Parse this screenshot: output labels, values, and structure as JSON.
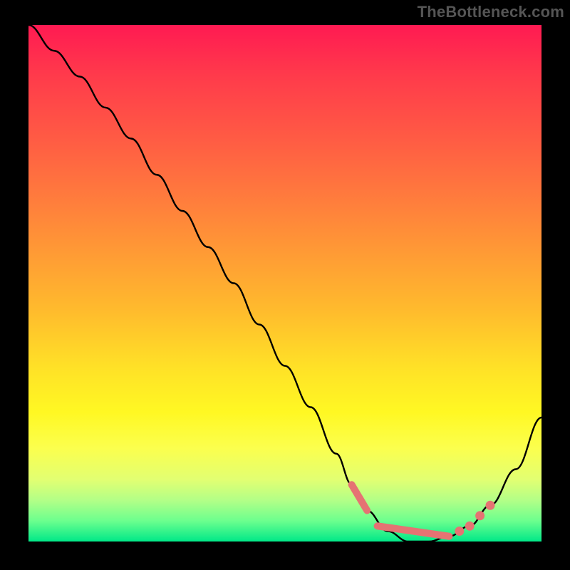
{
  "watermark": "TheBottleneck.com",
  "chart_data": {
    "type": "line",
    "title": "",
    "xlabel": "",
    "ylabel": "",
    "xlim": [
      0,
      100
    ],
    "ylim": [
      0,
      100
    ],
    "grid": false,
    "series": [
      {
        "name": "curve",
        "x": [
          0,
          5,
          10,
          15,
          20,
          25,
          30,
          35,
          40,
          45,
          50,
          55,
          60,
          63,
          66,
          70,
          74,
          78,
          82,
          86,
          90,
          95,
          100
        ],
        "y": [
          100,
          95,
          90,
          84,
          78,
          71,
          64,
          57,
          50,
          42,
          34,
          26,
          17,
          11,
          6,
          2,
          0,
          0,
          1,
          3,
          7,
          14,
          24
        ]
      }
    ],
    "markers": {
      "name": "highlight-region",
      "color": "#e57373",
      "segments": [
        {
          "x": [
            63,
            66
          ],
          "y": [
            11,
            6
          ]
        },
        {
          "x": [
            68,
            82
          ],
          "y": [
            3,
            1
          ]
        }
      ],
      "dots": [
        {
          "x": 84,
          "y": 2
        },
        {
          "x": 86,
          "y": 3
        },
        {
          "x": 88,
          "y": 5
        },
        {
          "x": 90,
          "y": 7
        }
      ]
    }
  }
}
